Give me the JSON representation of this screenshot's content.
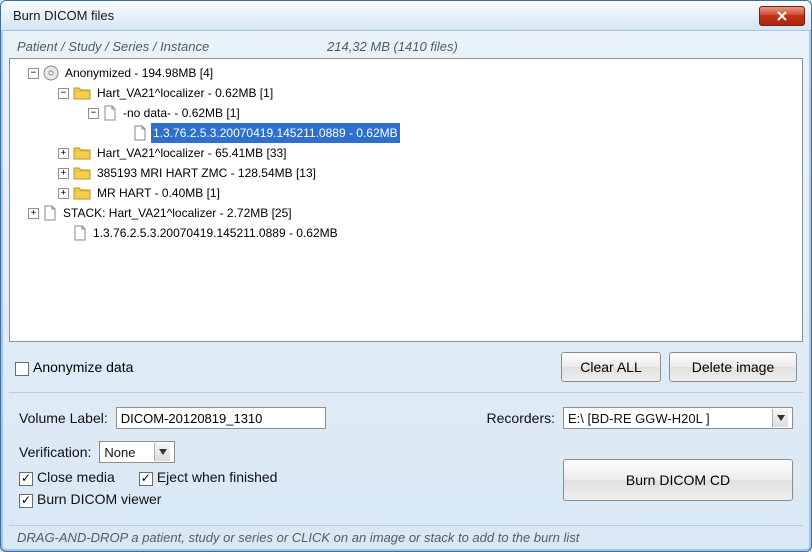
{
  "window": {
    "title": "Burn DICOM files"
  },
  "header": {
    "breadcrumb": "Patient / Study / Series / Instance",
    "summary": "214,32 MB  (1410 files)"
  },
  "tree": [
    {
      "depth": 0,
      "exp": "-",
      "icon": "cd",
      "label": "Anonymized  -  194.98MB  [4]",
      "sel": false
    },
    {
      "depth": 1,
      "exp": "-",
      "icon": "folder",
      "label": "Hart_VA21^localizer  -  0.62MB  [1]",
      "sel": false
    },
    {
      "depth": 2,
      "exp": "-",
      "icon": "page",
      "label": "-no data-  -  0.62MB  [1]",
      "sel": false
    },
    {
      "depth": 3,
      "exp": "",
      "icon": "page",
      "label": "1.3.76.2.5.3.20070419.145211.0889  -  0.62MB",
      "sel": true
    },
    {
      "depth": 1,
      "exp": "+",
      "icon": "folder",
      "label": "Hart_VA21^localizer  -  65.41MB  [33]",
      "sel": false
    },
    {
      "depth": 1,
      "exp": "+",
      "icon": "folder",
      "label": "385193 MRI HART ZMC  -  128.54MB  [13]",
      "sel": false
    },
    {
      "depth": 1,
      "exp": "+",
      "icon": "folder",
      "label": "MR HART  -  0.40MB  [1]",
      "sel": false
    },
    {
      "depth": 0,
      "exp": "+",
      "icon": "page",
      "label": "STACK: Hart_VA21^localizer  -  2.72MB  [25]",
      "sel": false
    },
    {
      "depth": 0,
      "exp": "",
      "icon": "page",
      "label": "1.3.76.2.5.3.20070419.145211.0889  -  0.62MB",
      "sel": false,
      "indent": 1
    }
  ],
  "controls": {
    "anonymize_label": "Anonymize data",
    "anonymize_checked": false,
    "clear_all": "Clear ALL",
    "delete_image": "Delete image",
    "volume_label_lbl": "Volume Label:",
    "volume_label_value": "DICOM-20120819_1310",
    "recorders_lbl": "Recorders:",
    "recorders_value": "E:\\ [BD-RE  GGW-H20L ]",
    "verification_lbl": "Verification:",
    "verification_value": "None",
    "close_media_label": "Close media",
    "close_media_checked": true,
    "eject_label": "Eject when finished",
    "eject_checked": true,
    "burn_viewer_label": "Burn DICOM viewer",
    "burn_viewer_checked": true,
    "burn_button": "Burn DICOM CD"
  },
  "statusbar": "DRAG-AND-DROP a patient, study or series or CLICK on an image or stack to add to the burn list"
}
